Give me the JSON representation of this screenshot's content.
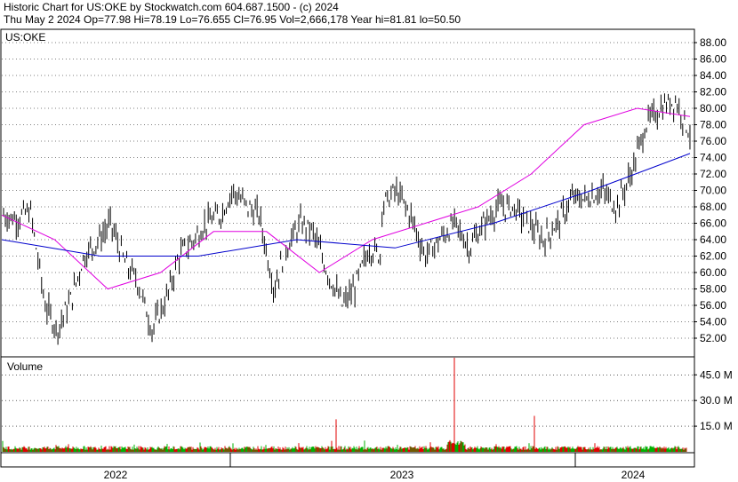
{
  "header": {
    "line1": "Historic Chart for US:OKE by Stockwatch.com 604.687.1500 - (c) 2024",
    "line2": "Thu May  2 2024   Op=77.98  Hi=78.19  Lo=76.655  Cl=76.95  Vol=2,666,178  Year hi=81.81  lo=50.50"
  },
  "chart_data": {
    "type": "candlestick",
    "symbol_label": "US:OKE",
    "price_axis": {
      "min": 50,
      "max": 90,
      "ticks": [
        "88.00",
        "86.00",
        "84.00",
        "82.00",
        "80.00",
        "78.00",
        "76.00",
        "74.00",
        "72.00",
        "70.00",
        "68.00",
        "66.00",
        "64.00",
        "62.00",
        "60.00",
        "58.00",
        "56.00",
        "54.00",
        "52.00"
      ]
    },
    "volume_panel": {
      "label": "Volume",
      "min": 0,
      "max": 55,
      "unit": "M",
      "ticks": [
        "45.0 M",
        "30.0 M",
        "15.0 M"
      ]
    },
    "x_axis": {
      "labels": [
        "2022",
        "2023",
        "2024"
      ]
    },
    "price_series": {
      "x": [
        0,
        4,
        9,
        14,
        18,
        23,
        27,
        32,
        36,
        41,
        45,
        50,
        55,
        59,
        64,
        68,
        73,
        77,
        82,
        86,
        91,
        95,
        100,
        104,
        109,
        114,
        118,
        123,
        127
      ],
      "y": [
        67,
        66.5,
        67.5,
        56,
        53,
        57,
        62,
        64,
        66,
        61,
        59,
        53,
        57,
        62,
        64,
        66,
        67,
        70,
        68,
        67,
        58,
        63,
        66,
        65,
        60,
        56,
        58,
        63,
        62
      ]
    },
    "price_series_b": {
      "x": [
        0,
        5,
        10,
        15,
        20,
        25,
        30,
        35,
        40,
        45,
        50,
        55,
        60,
        65,
        70,
        75,
        80,
        85,
        90,
        95,
        100,
        105
      ],
      "y": [
        68,
        70,
        67,
        62,
        64,
        66,
        63,
        66,
        68,
        68,
        66,
        64,
        66,
        69,
        69,
        70,
        68,
        72,
        78,
        80,
        81,
        77
      ]
    },
    "ma_short": {
      "x": [
        0,
        10,
        20,
        30,
        40,
        50,
        60,
        70,
        80,
        90,
        100,
        110,
        120,
        130
      ],
      "y": [
        67,
        64,
        58,
        60,
        65,
        65,
        60,
        64,
        66,
        68,
        72,
        78,
        80,
        79
      ]
    },
    "ma_long": {
      "x": [
        0,
        20,
        40,
        60,
        80,
        100,
        120,
        140
      ],
      "y": [
        64,
        62,
        62,
        64,
        63,
        66,
        70,
        74.5
      ]
    },
    "volume": {
      "notable_spikes": [
        {
          "period": "2022 Q1",
          "value": 4
        },
        {
          "period": "2023 Q1",
          "value": 19
        },
        {
          "period": "2023 Q3",
          "value": 55
        },
        {
          "period": "2024 Q1",
          "value": 21
        }
      ]
    },
    "colors": {
      "candle": "#000000",
      "ma_short": "#e000e0",
      "ma_long": "#0000cc",
      "vol_up": "#00b000",
      "vol_down": "#e00000",
      "grid": "#000000"
    }
  }
}
